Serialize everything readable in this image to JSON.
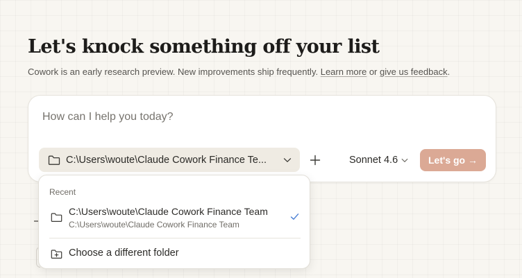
{
  "header": {
    "title": "Let's knock something off your list",
    "subtitle_text": "Cowork is an early research preview. New improvements ship frequently. ",
    "learn_more_link": "Learn more",
    "or_text": " or ",
    "feedback_link": "give us feedback",
    "period": "."
  },
  "composer": {
    "placeholder": "How can I help you today?",
    "folder_label": "C:\\Users\\woute\\Claude Cowork Finance Te...",
    "model_label": "Sonnet 4.6",
    "go_button_label": "Let's go →"
  },
  "folder_dropdown": {
    "section_label": "Recent",
    "recent_items": [
      {
        "name": "C:\\Users\\woute\\Claude Cowork Finance Team",
        "path": "C:\\Users\\woute\\Claude Cowork Finance Team",
        "selected": true
      }
    ],
    "choose_label": "Choose a different folder"
  },
  "icons": {
    "folder": "folder-icon",
    "chevron": "chevron-down-icon",
    "plus": "plus-icon",
    "check": "check-icon",
    "new_folder": "folder-plus-icon"
  },
  "colors": {
    "background": "#f8f6f1",
    "accent_button": "#dba995",
    "check": "#4a7fd4"
  }
}
